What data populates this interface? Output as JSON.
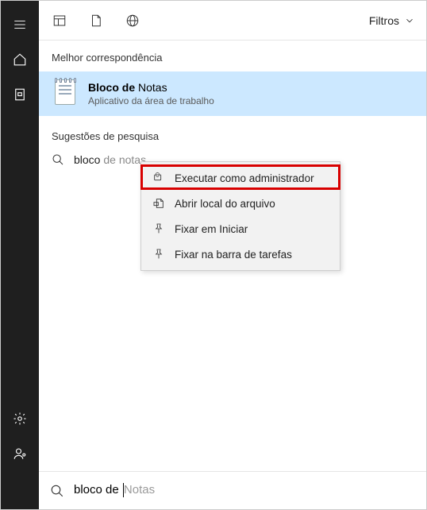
{
  "leftbar": {
    "items": [
      "menu",
      "home",
      "document",
      "settings",
      "user"
    ]
  },
  "topbar": {
    "filters_label": "Filtros"
  },
  "best_match": {
    "section_label": "Melhor correspondência",
    "title_bold": "Bloco de",
    "title_rest": " Notas",
    "subtitle": "Aplicativo da área de trabalho"
  },
  "suggestions": {
    "section_label": "Sugestões de pesquisa",
    "item_prefix": "bloco",
    "item_gray": " de notas"
  },
  "context_menu": {
    "items": [
      {
        "label": "Executar como administrador",
        "icon": "shield"
      },
      {
        "label": "Abrir local do arquivo",
        "icon": "folder"
      },
      {
        "label": "Fixar em Iniciar",
        "icon": "pin"
      },
      {
        "label": "Fixar na barra de tarefas",
        "icon": "pin"
      }
    ]
  },
  "search": {
    "typed": "bloco de ",
    "ghost": "Notas"
  }
}
